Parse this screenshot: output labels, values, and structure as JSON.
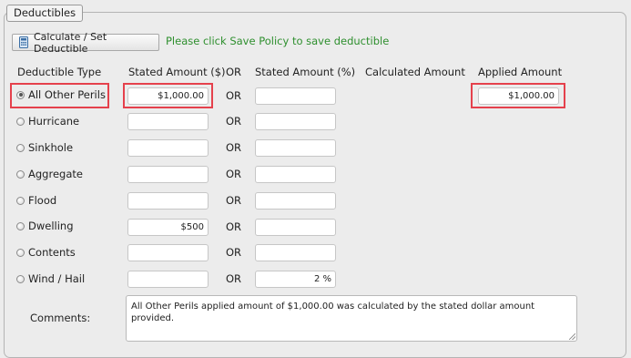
{
  "section": {
    "title": "Deductibles"
  },
  "toolbar": {
    "calc_label": "Calculate / Set Deductible",
    "message": "Please click Save Policy to save deductible"
  },
  "headers": {
    "type": "Deductible Type",
    "stated_amount": "Stated Amount ($)",
    "or": "OR",
    "stated_percent": "Stated Amount (%)",
    "calculated": "Calculated Amount",
    "applied": "Applied Amount"
  },
  "rows": [
    {
      "label": "All Other Perils",
      "selected": true,
      "amount": "$1,000.00",
      "percent": "",
      "applied": "$1,000.00"
    },
    {
      "label": "Hurricane",
      "selected": false,
      "amount": "",
      "percent": ""
    },
    {
      "label": "Sinkhole",
      "selected": false,
      "amount": "",
      "percent": ""
    },
    {
      "label": "Aggregate",
      "selected": false,
      "amount": "",
      "percent": ""
    },
    {
      "label": "Flood",
      "selected": false,
      "amount": "",
      "percent": ""
    },
    {
      "label": "Dwelling",
      "selected": false,
      "amount": "$500",
      "percent": ""
    },
    {
      "label": "Contents",
      "selected": false,
      "amount": "",
      "percent": ""
    },
    {
      "label": "Wind / Hail",
      "selected": false,
      "amount": "",
      "percent": "2 %"
    }
  ],
  "comments": {
    "label": "Comments:",
    "value": "All Other Perils applied amount of $1,000.00 was calculated by the stated dollar amount provided."
  },
  "colors": {
    "message": "#2e8f2e",
    "highlight": "#e5414c"
  }
}
